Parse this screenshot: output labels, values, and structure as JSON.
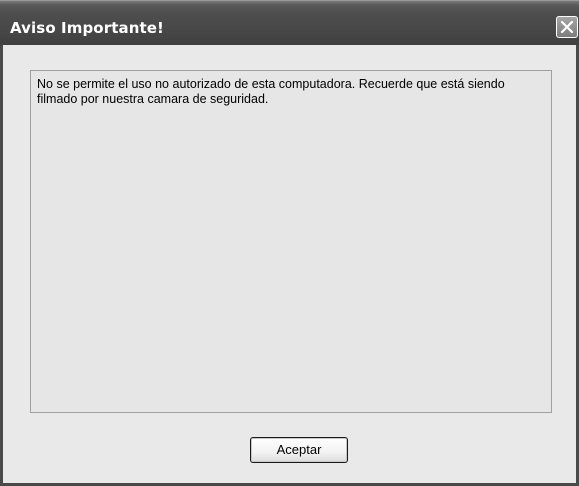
{
  "dialog": {
    "title": "Aviso Importante!",
    "message": "No se permite el uso no autorizado de esta computadora. Recuerde que está siendo filmado por nuestra camara de seguridad.",
    "ok_label": "Aceptar",
    "close_icon": "close-icon"
  }
}
